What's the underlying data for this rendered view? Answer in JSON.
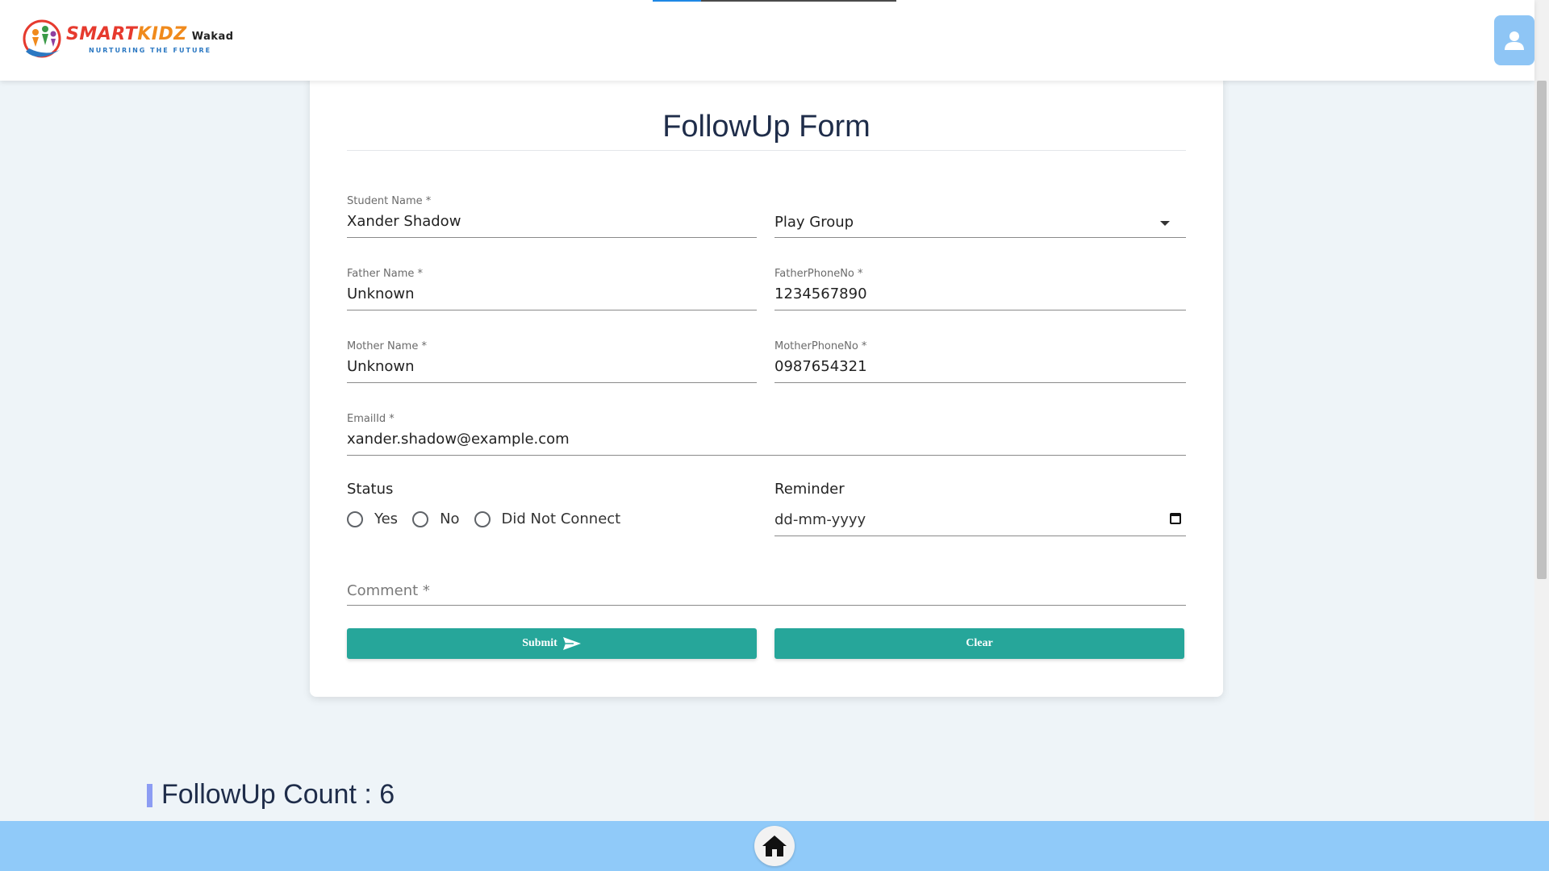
{
  "header": {
    "logo": {
      "brand_smart": "SMART",
      "brand_kidz": "KIDZ",
      "branch": "Wakad",
      "tagline": "NURTURING THE FUTURE"
    },
    "profile_icon": "user-icon"
  },
  "form": {
    "title": "FollowUp Form",
    "student_name": {
      "label": "Student Name *",
      "value": "Xander Shadow"
    },
    "class_select": {
      "value": "Play Group"
    },
    "father_name": {
      "label": "Father Name *",
      "value": "Unknown"
    },
    "father_phone": {
      "label": "FatherPhoneNo *",
      "value": "1234567890"
    },
    "mother_name": {
      "label": "Mother Name *",
      "value": "Unknown"
    },
    "mother_phone": {
      "label": "MotherPhoneNo *",
      "value": "0987654321"
    },
    "email": {
      "label": "EmailId *",
      "value": "xander.shadow@example.com"
    },
    "status": {
      "label": "Status",
      "options": [
        "Yes",
        "No",
        "Did Not Connect"
      ]
    },
    "reminder": {
      "label": "Reminder",
      "placeholder": "dd-mm-yyyy"
    },
    "comment": {
      "placeholder": "Comment *"
    },
    "submit_label": "Submit",
    "clear_label": "Clear"
  },
  "followup_count": "FollowUp Count : 6",
  "colors": {
    "primary_button": "#26a69a",
    "footer": "#90caf9",
    "avatar_button": "#8ec5f5",
    "title": "#1f2d4a",
    "count_accent": "#8c9cf3"
  },
  "footer": {
    "home_icon": "home-icon"
  }
}
